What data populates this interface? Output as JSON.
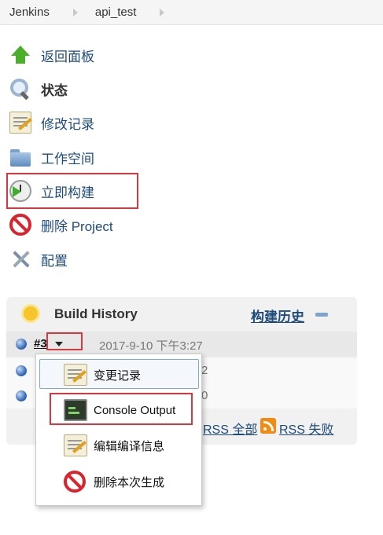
{
  "breadcrumb": {
    "items": [
      "Jenkins",
      "api_test"
    ]
  },
  "tasks": [
    {
      "label": "返回面板",
      "icon": "up-arrow-icon"
    },
    {
      "label": "状态",
      "icon": "search-icon"
    },
    {
      "label": "修改记录",
      "icon": "notepad-icon"
    },
    {
      "label": "工作空间",
      "icon": "folder-icon"
    },
    {
      "label": "立即构建",
      "icon": "clock-icon"
    },
    {
      "label": "删除 Project",
      "icon": "no-entry-icon"
    },
    {
      "label": "配置",
      "icon": "tools-icon"
    }
  ],
  "build_history": {
    "title": "Build History",
    "trend_label": "构建历史",
    "builds": [
      {
        "number": "#3",
        "date": "2017-9-10 下午3:27"
      },
      {
        "trunc": "2"
      },
      {
        "trunc": "0"
      }
    ],
    "rss_all": "RSS 全部",
    "rss_failures": "RSS 失败"
  },
  "context_menu": {
    "items": [
      {
        "label": "变更记录",
        "icon": "notepad-icon"
      },
      {
        "label": "Console Output",
        "icon": "console-icon"
      },
      {
        "label": "编辑编译信息",
        "icon": "notepad-icon"
      },
      {
        "label": "删除本次生成",
        "icon": "no-entry-icon"
      }
    ]
  },
  "colors": {
    "link": "#1e4b7a",
    "highlight_box": "#d9363e",
    "build_ball": "#2f64b7"
  }
}
